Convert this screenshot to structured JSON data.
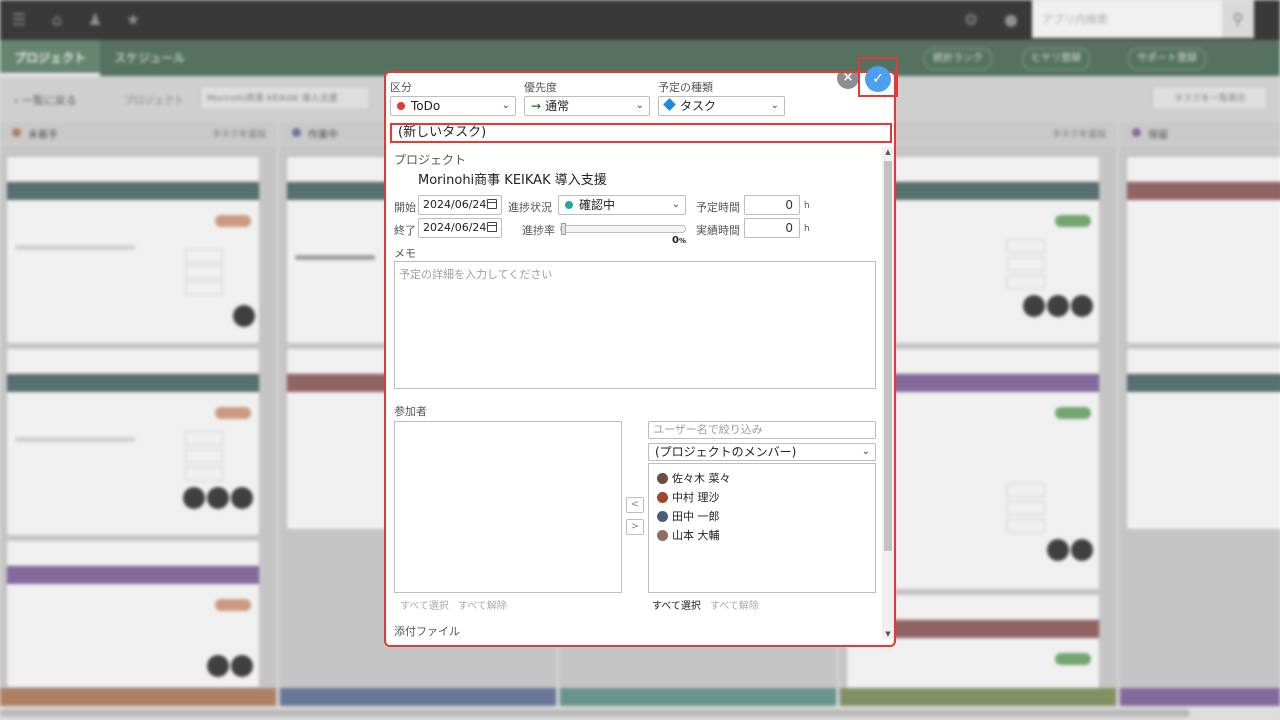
{
  "background": {
    "search_placeholder": "アプリ内検索",
    "nav_tabs": [
      "プロジェクト",
      "スケジュール"
    ],
    "nav_pills": [
      "統計ランク",
      "ヒヤリ登録",
      "サポート登録"
    ],
    "back_label": "一覧に戻る",
    "breadcrumb_label": "プロジェクト",
    "breadcrumb_value": "Morinohi商事 KEIKAK 導入支援",
    "right_button": "タスクを一覧表示",
    "columns": [
      {
        "title": "未着手",
        "add": "タスクを追加",
        "color": "#b9896a"
      },
      {
        "title": "作業中",
        "add": "",
        "color": "#6f7fa0"
      },
      {
        "title": "",
        "add": "",
        "color": "#6f9e94"
      },
      {
        "title": "",
        "add": "タスクを追加",
        "color": "#8a9a6a"
      },
      {
        "title": "保留",
        "add": "",
        "color": "#8b72a6"
      }
    ]
  },
  "dialog": {
    "labels": {
      "kubun": "区分",
      "priority": "優先度",
      "schedule_type": "予定の種類",
      "project": "プロジェクト",
      "start": "開始",
      "end": "終了",
      "progress_status": "進捗状況",
      "progress_rate": "進捗率",
      "planned_time": "予定時間",
      "actual_time": "実績時間",
      "memo": "メモ",
      "participants": "参加者",
      "attachments": "添付ファイル"
    },
    "kubun": {
      "value": "ToDo",
      "color": "#e53935"
    },
    "priority": {
      "value": "通常",
      "arrow": "→"
    },
    "schedule_type": {
      "value": "タスク"
    },
    "title": "(新しいタスク)",
    "project_name": "Morinohi商事 KEIKAK 導入支援",
    "start_date": "2024/06/24",
    "end_date": "2024/06/24",
    "status": {
      "value": "確認中",
      "color": "#26a69a"
    },
    "progress_percent": 0,
    "progress_label": "0",
    "percent_sign": "%",
    "planned_hours": "0",
    "actual_hours": "0",
    "hour_unit": "h",
    "memo_placeholder": "予定の詳細を入力してください",
    "user_filter_placeholder": "ユーザー名で絞り込み",
    "member_group": "(プロジェクトのメンバー)",
    "members": [
      "佐々木 菜々",
      "中村 理沙",
      "田中 一郎",
      "山本 大輔"
    ],
    "select_all": "すべて選択",
    "deselect_all": "すべて解除",
    "close_symbol": "×",
    "confirm_symbol": "✓",
    "move_left": "<",
    "move_right": ">"
  }
}
